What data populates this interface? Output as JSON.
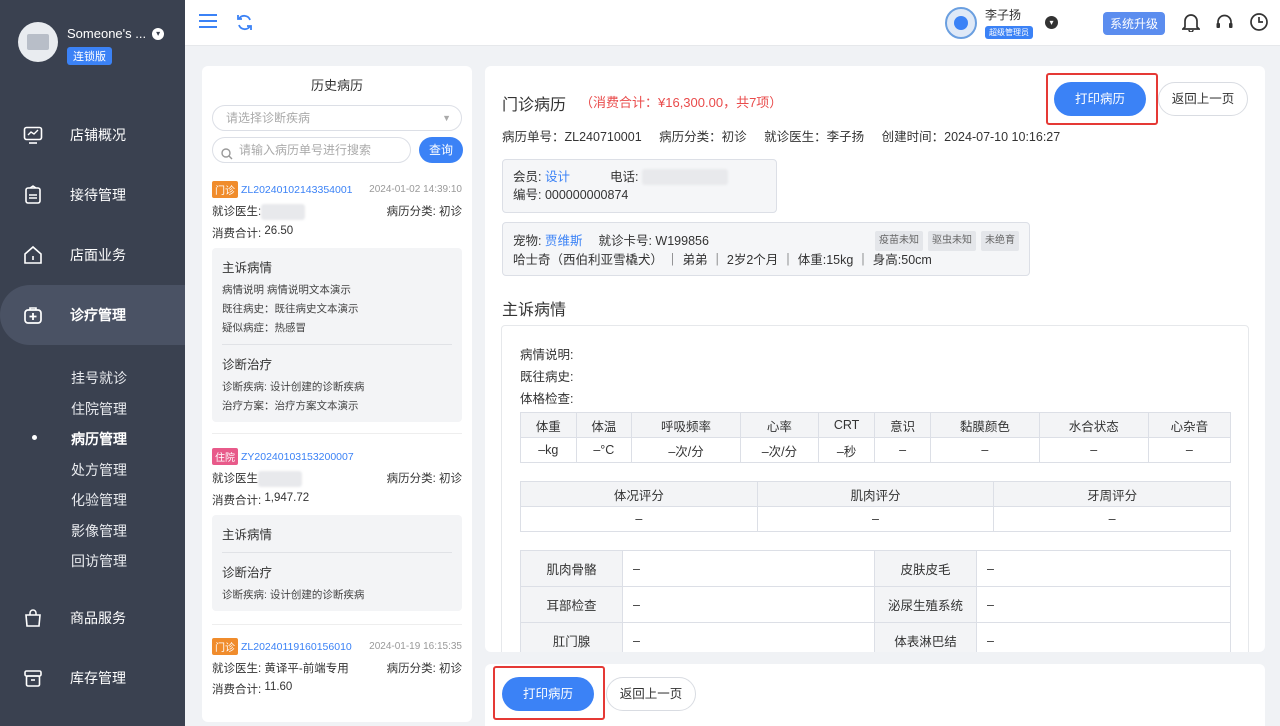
{
  "sidebar": {
    "brand_name": "Someone's ...",
    "brand_badge": "连锁版",
    "nav": [
      {
        "label": "店铺概况",
        "icon": "monitor-icon"
      },
      {
        "label": "接待管理",
        "icon": "clipboard-icon"
      },
      {
        "label": "店面业务",
        "icon": "home-icon"
      },
      {
        "label": "诊疗管理",
        "icon": "medkit-icon"
      },
      {
        "label": "商品服务",
        "icon": "bag-icon"
      },
      {
        "label": "库存管理",
        "icon": "box-icon"
      }
    ],
    "sub_items": [
      "挂号就诊",
      "住院管理",
      "病历管理",
      "处方管理",
      "化验管理",
      "影像管理",
      "回访管理"
    ]
  },
  "topbar": {
    "user_name": "李子扬",
    "user_role": "超级管理员",
    "upgrade_label": "系统升级"
  },
  "history": {
    "title": "历史病历",
    "select_placeholder": "请选择诊断疾病",
    "search_placeholder": "请输入病历单号进行搜索",
    "query_label": "查询",
    "doctor_label": "就诊医生",
    "category_label": "病历分类:",
    "total_label": "消费合计:",
    "records": [
      {
        "tag": "门诊",
        "no": "ZL20240102143354001",
        "time": "2024-01-02 14:39:10",
        "doctor": "",
        "category": "初诊",
        "total": "26.50",
        "complaint_title": "主诉病情",
        "complaint_lines": [
          "病情说明 病情说明文本演示",
          "既往病史：既往病史文本演示",
          "疑似病症：热感冒"
        ],
        "treat_title": "诊断治疗",
        "treat_lines": [
          "诊断疾病: 设计创建的诊断疾病",
          "治疗方案：治疗方案文本演示"
        ]
      },
      {
        "tag": "住院",
        "no": "ZY20240103153200007",
        "time": "",
        "doctor": "",
        "category": "初诊",
        "total": "1,947.72",
        "complaint_title": "主诉病情",
        "treat_title": "诊断治疗",
        "treat_lines": [
          "诊断疾病: 设计创建的诊断疾病"
        ]
      },
      {
        "tag": "门诊",
        "no": "ZL20240119160156010",
        "time": "2024-01-19 16:15:35",
        "doctor": "黄译平-前端专用",
        "category": "初诊",
        "total": "11.60"
      }
    ]
  },
  "main": {
    "title": "门诊病历",
    "total": "（消费合计：¥16,300.00，共7项）",
    "print_label": "打印病历",
    "back_label": "返回上一页",
    "record_no": "病历单号：ZL240710001",
    "category": "病历分类：初诊",
    "doctor": "就诊医生：李子扬",
    "created": "创建时间：2024-07-10 10:16:27",
    "member_label": "会员:",
    "member_name": "设计",
    "phone_label": "电话:",
    "member_no": "编号: 000000000874",
    "pet_label": "宠物:",
    "pet_name": "贾维斯",
    "card_no": "就诊卡号: W199856",
    "pet_tags": [
      "疫苗未知",
      "驱虫未知",
      "未绝育"
    ],
    "pet_detail": "哈士奇（西伯利亚雪橇犬） ｜ 弟弟 ｜ 2岁2个月 ｜ 体重:15kg ｜ 身高:50cm",
    "section_title": "主诉病情",
    "desc_label": "病情说明:",
    "history_label": "既往病史:",
    "exam_label": "体格检查:",
    "vitals_headers": [
      "体重",
      "体温",
      "呼吸频率",
      "心率",
      "CRT",
      "意识",
      "黏膜颜色",
      "水合状态",
      "心杂音"
    ],
    "vitals_values": [
      "–kg",
      "–°C",
      "–次/分",
      "–次/分",
      "–秒",
      "–",
      "–",
      "–",
      "–"
    ],
    "score_headers": [
      "体况评分",
      "肌肉评分",
      "牙周评分"
    ],
    "score_values": [
      "–",
      "–",
      "–"
    ],
    "systems": [
      {
        "k1": "肌肉骨骼",
        "v1": "–",
        "k2": "皮肤皮毛",
        "v2": "–"
      },
      {
        "k1": "耳部检查",
        "v1": "–",
        "k2": "泌尿生殖系统",
        "v2": "–"
      },
      {
        "k1": "肛门腺",
        "v1": "–",
        "k2": "体表淋巴结",
        "v2": "–"
      }
    ]
  },
  "colors": {
    "accent": "#3b82f6",
    "sidebar": "#3a4150",
    "danger": "#e94b4b"
  }
}
